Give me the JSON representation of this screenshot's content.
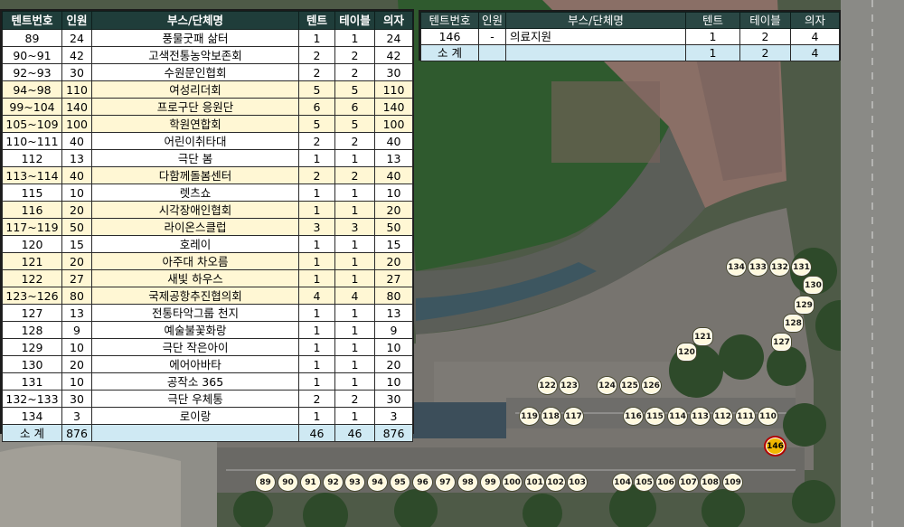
{
  "colors": {
    "header_bg": "#1f3d3a",
    "highlight_row": "#fff7d4",
    "total_row": "#cfe9f3",
    "marker_fill": "#fff9de",
    "special_marker": "#f2b700"
  },
  "left_table": {
    "headers": [
      "텐트번호",
      "인원",
      "부스/단체명",
      "텐트",
      "테이블",
      "의자"
    ],
    "rows": [
      {
        "no": "89",
        "people": "24",
        "name": "풍물굿패 삶터",
        "tent": "1",
        "table": "1",
        "chair": "24",
        "hl": false
      },
      {
        "no": "90~91",
        "people": "42",
        "name": "고색전통농악보존회",
        "tent": "2",
        "table": "2",
        "chair": "42",
        "hl": false
      },
      {
        "no": "92~93",
        "people": "30",
        "name": "수원문인협회",
        "tent": "2",
        "table": "2",
        "chair": "30",
        "hl": false
      },
      {
        "no": "94~98",
        "people": "110",
        "name": "여성리더회",
        "tent": "5",
        "table": "5",
        "chair": "110",
        "hl": true
      },
      {
        "no": "99~104",
        "people": "140",
        "name": "프로구단 응원단",
        "tent": "6",
        "table": "6",
        "chair": "140",
        "hl": true
      },
      {
        "no": "105~109",
        "people": "100",
        "name": "학원연합회",
        "tent": "5",
        "table": "5",
        "chair": "100",
        "hl": true
      },
      {
        "no": "110~111",
        "people": "40",
        "name": "어린이취타대",
        "tent": "2",
        "table": "2",
        "chair": "40",
        "hl": false
      },
      {
        "no": "112",
        "people": "13",
        "name": "극단 봄",
        "tent": "1",
        "table": "1",
        "chair": "13",
        "hl": false
      },
      {
        "no": "113~114",
        "people": "40",
        "name": "다함께돌봄센터",
        "tent": "2",
        "table": "2",
        "chair": "40",
        "hl": true
      },
      {
        "no": "115",
        "people": "10",
        "name": "렛츠쇼",
        "tent": "1",
        "table": "1",
        "chair": "10",
        "hl": false
      },
      {
        "no": "116",
        "people": "20",
        "name": "시각장애인협회",
        "tent": "1",
        "table": "1",
        "chair": "20",
        "hl": true
      },
      {
        "no": "117~119",
        "people": "50",
        "name": "라이온스클럽",
        "tent": "3",
        "table": "3",
        "chair": "50",
        "hl": true
      },
      {
        "no": "120",
        "people": "15",
        "name": "호레이",
        "tent": "1",
        "table": "1",
        "chair": "15",
        "hl": false
      },
      {
        "no": "121",
        "people": "20",
        "name": "아주대 차오름",
        "tent": "1",
        "table": "1",
        "chair": "20",
        "hl": true
      },
      {
        "no": "122",
        "people": "27",
        "name": "새빛 하우스",
        "tent": "1",
        "table": "1",
        "chair": "27",
        "hl": true
      },
      {
        "no": "123~126",
        "people": "80",
        "name": "국제공항추진협의회",
        "tent": "4",
        "table": "4",
        "chair": "80",
        "hl": true
      },
      {
        "no": "127",
        "people": "13",
        "name": "전통타악그룹 천지",
        "tent": "1",
        "table": "1",
        "chair": "13",
        "hl": false
      },
      {
        "no": "128",
        "people": "9",
        "name": "예술불꽃화랑",
        "tent": "1",
        "table": "1",
        "chair": "9",
        "hl": false
      },
      {
        "no": "129",
        "people": "10",
        "name": "극단 작은아이",
        "tent": "1",
        "table": "1",
        "chair": "10",
        "hl": false
      },
      {
        "no": "130",
        "people": "20",
        "name": "에어아바타",
        "tent": "1",
        "table": "1",
        "chair": "20",
        "hl": false
      },
      {
        "no": "131",
        "people": "10",
        "name": "공작소 365",
        "tent": "1",
        "table": "1",
        "chair": "10",
        "hl": false
      },
      {
        "no": "132~133",
        "people": "30",
        "name": "극단 우체통",
        "tent": "2",
        "table": "2",
        "chair": "30",
        "hl": false
      },
      {
        "no": "134",
        "people": "3",
        "name": "로이랑",
        "tent": "1",
        "table": "1",
        "chair": "3",
        "hl": false
      }
    ],
    "total": {
      "label": "소 계",
      "people": "876",
      "name": "",
      "tent": "46",
      "table": "46",
      "chair": "876"
    }
  },
  "right_table": {
    "headers": [
      "텐트번호",
      "인원",
      "부스/단체명",
      "텐트",
      "테이블",
      "의자"
    ],
    "rows": [
      {
        "no": "146",
        "people": "-",
        "name": "의료지원",
        "tent": "1",
        "table": "2",
        "chair": "4"
      }
    ],
    "total": {
      "label": "소 계",
      "people": "",
      "name": "",
      "tent": "1",
      "table": "2",
      "chair": "4"
    }
  },
  "map_markers": {
    "bottom_row": [
      "89",
      "90",
      "91",
      "92",
      "93",
      "94",
      "95",
      "96",
      "97",
      "98",
      "99",
      "100",
      "101",
      "102",
      "103",
      "104",
      "105",
      "106",
      "107",
      "108",
      "109"
    ],
    "middle_row": [
      "119",
      "118",
      "117",
      "116",
      "115",
      "114",
      "113",
      "112",
      "111",
      "110"
    ],
    "upper_row": [
      "122",
      "123",
      "124",
      "125",
      "126"
    ],
    "pair": [
      "120",
      "121"
    ],
    "top_cluster": [
      "134",
      "133",
      "132",
      "131"
    ],
    "side_cluster": [
      "130",
      "129",
      "128",
      "127"
    ],
    "special": "146"
  }
}
